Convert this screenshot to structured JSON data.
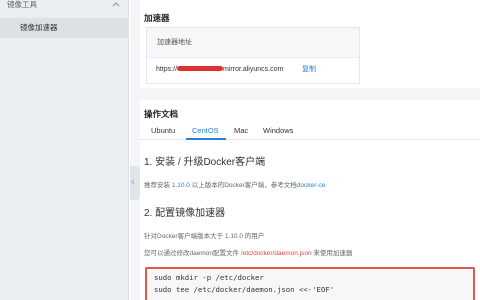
{
  "sidebar": {
    "group_label": "镜像工具",
    "active_item_label": "镜像加速器"
  },
  "accelerator": {
    "title": "加速器",
    "box_header": "加速器地址",
    "url_prefix": "https://",
    "url_suffix": "mirror.aliyuncs.com",
    "copy_label": "复制"
  },
  "docs": {
    "title": "操作文档",
    "tabs": [
      {
        "label": "Ubuntu"
      },
      {
        "label": "CentOS"
      },
      {
        "label": "Mac"
      },
      {
        "label": "Windows"
      }
    ],
    "active_tab": "CentOS",
    "section1_heading": "1. 安装 / 升级Docker客户端",
    "section1_text_a": "推荐安装 ",
    "section1_version": "1.10.0",
    "section1_text_b": " 以上版本的Docker客户端，参考文档",
    "section1_link": "docker-ce",
    "section2_heading": "2. 配置镜像加速器",
    "section2_line1": "针对Docker客户端版本大于 1.10.0 的用户",
    "section2_line2_a": "您可以通过修改daemon配置文件 ",
    "section2_path": "/etc/docker/daemon.json",
    "section2_line2_b": " 来使用加速器",
    "code_lines": [
      "sudo mkdir -p /etc/docker",
      "sudo tee /etc/docker/daemon.json <<-'EOF'"
    ]
  },
  "colors": {
    "accent": "#2f7fd6",
    "highlight_border": "#e2574c",
    "path_red": "#e0453a",
    "redaction": "#e03030"
  },
  "icons": {
    "sidebar_chevron": "chevron-up-icon",
    "collapse_handle": "chevron-left-icon"
  }
}
